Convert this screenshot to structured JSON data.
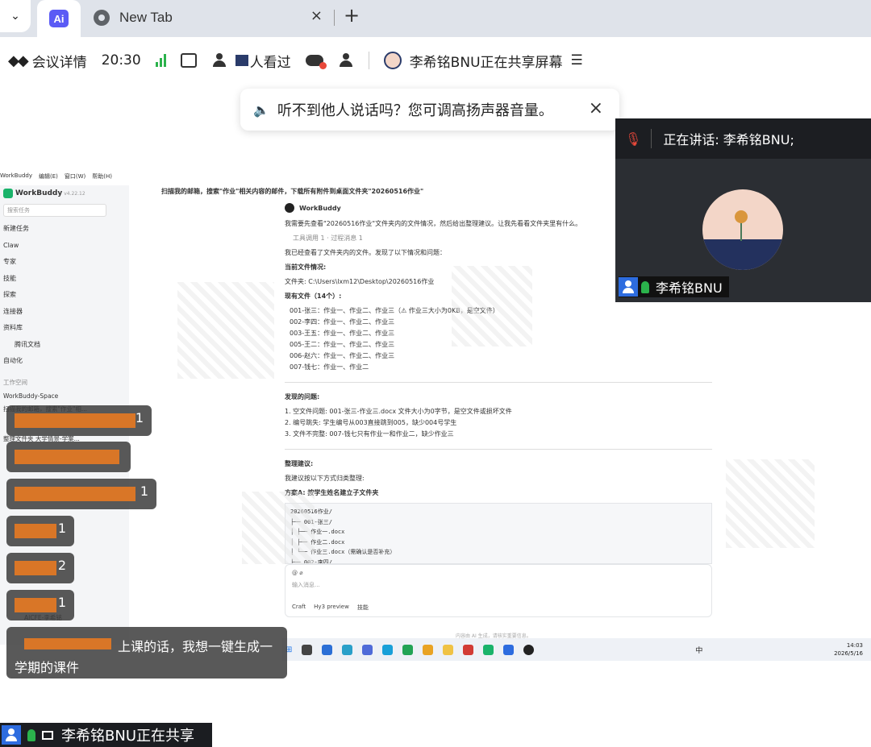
{
  "browser": {
    "tab_ai_label": "Ai",
    "tab_newtab_title": "New Tab",
    "tab_close": "×",
    "tab_add": "+",
    "menu_chevron": "⌄"
  },
  "meeting_bar": {
    "details_label": "会议详情",
    "time": "20:30",
    "viewers_label": "人看过",
    "sharer_status": "李希铭BNU正在共享屏幕",
    "accent_green": "#2bb24c",
    "alert_red": "#e8483a"
  },
  "notice": {
    "text": "听不到他人说话吗？您可调高扬声器音量。",
    "close": "×"
  },
  "video_panel": {
    "speaking_label": "正在讲话:  李希铭BNU;",
    "name": "李希铭BNU"
  },
  "shared_app": {
    "menubar": [
      "WorkBuddy",
      "编辑(E)",
      "窗口(W)",
      "帮助(H)"
    ],
    "app_name": "WorkBuddy",
    "version": "v4.22.12",
    "search_placeholder": "搜索任务",
    "nav": [
      "新建任务",
      "Claw",
      "专家",
      "技能",
      "探索",
      "连接器",
      "资料库",
      "腾讯文档",
      "自动化"
    ],
    "workspace_label": "工作空间",
    "workspace_name": "WorkBuddy-Space",
    "tasks": [
      "扫描我的邮箱，搜索\"作业\"相...",
      "整理文件夹 大学情景-学案..."
    ],
    "user": "AICFE-李希铭",
    "task_title": "扫描我的邮箱，搜索\"作业\"相关内容的邮件，下载所有附件到桌面文件夹\"20260516作业\"",
    "bot_name": "WorkBuddy",
    "intro": "我需要先查看\"20260516作业\"文件夹内的文件情况，然后给出整理建议。让我先看看文件夹里有什么。",
    "tools_line": "工具调用 1 · 过程消息 1",
    "checked": "我已经查看了文件夹内的文件。发现了以下情况和问题：",
    "current_heading": "当前文件情况:",
    "folder_line": "文件夹: C:\\Users\\lxm12\\Desktop\\20260516作业",
    "files_heading": "现有文件（14个）:",
    "files": [
      "001-张三：作业一、作业二、作业三（⚠ 作业三大小为0KB，是空文件）",
      "002-李四：作业一、作业二、作业三",
      "003-王五：作业一、作业二、作业三",
      "005-王二：作业一、作业二、作业三",
      "006-赵六：作业一、作业二、作业三",
      "007-钱七：作业一、作业二"
    ],
    "issues_heading": "发现的问题:",
    "issues": [
      "1. 空文件问题: 001-张三-作业三.docx 文件大小为0字节，是空文件或损坏文件",
      "2. 编号跳失: 学生编号从003直接跳到005，缺少004号学生",
      "3. 文件不完整: 007-钱七只有作业一和作业二，缺少作业三"
    ],
    "suggest_heading": "整理建议:",
    "suggest_intro": "我建议按以下方式归类整理:",
    "plan_a": "方案A: 按学生姓名建立子文件夹",
    "code_lines": [
      "20260516作业/",
      "├── 001-张三/",
      "│   ├── 作业一.docx",
      "│   ├── 作业二.docx",
      "│   └── 作业三.docx（需确认是否补充）",
      "├── 002-李四/"
    ],
    "input_placeholder": "输入消息...",
    "mode_craft": "Craft",
    "model": "Hy3 preview",
    "skills": "技能",
    "footer_note": "内容由 AI 生成，请核实重要信息。",
    "clock_time": "14:03",
    "clock_date": "2026/5/16",
    "ime": "中"
  },
  "bubbles": [
    {
      "count": "1"
    },
    {
      "count": ""
    },
    {
      "count": "1"
    },
    {
      "count": "1"
    },
    {
      "count": "2"
    },
    {
      "count": "1"
    },
    {
      "text": "上课的话，我想一键生成一学期的课件"
    }
  ],
  "bottom_status": {
    "text": "李希铭BNU正在共享"
  }
}
